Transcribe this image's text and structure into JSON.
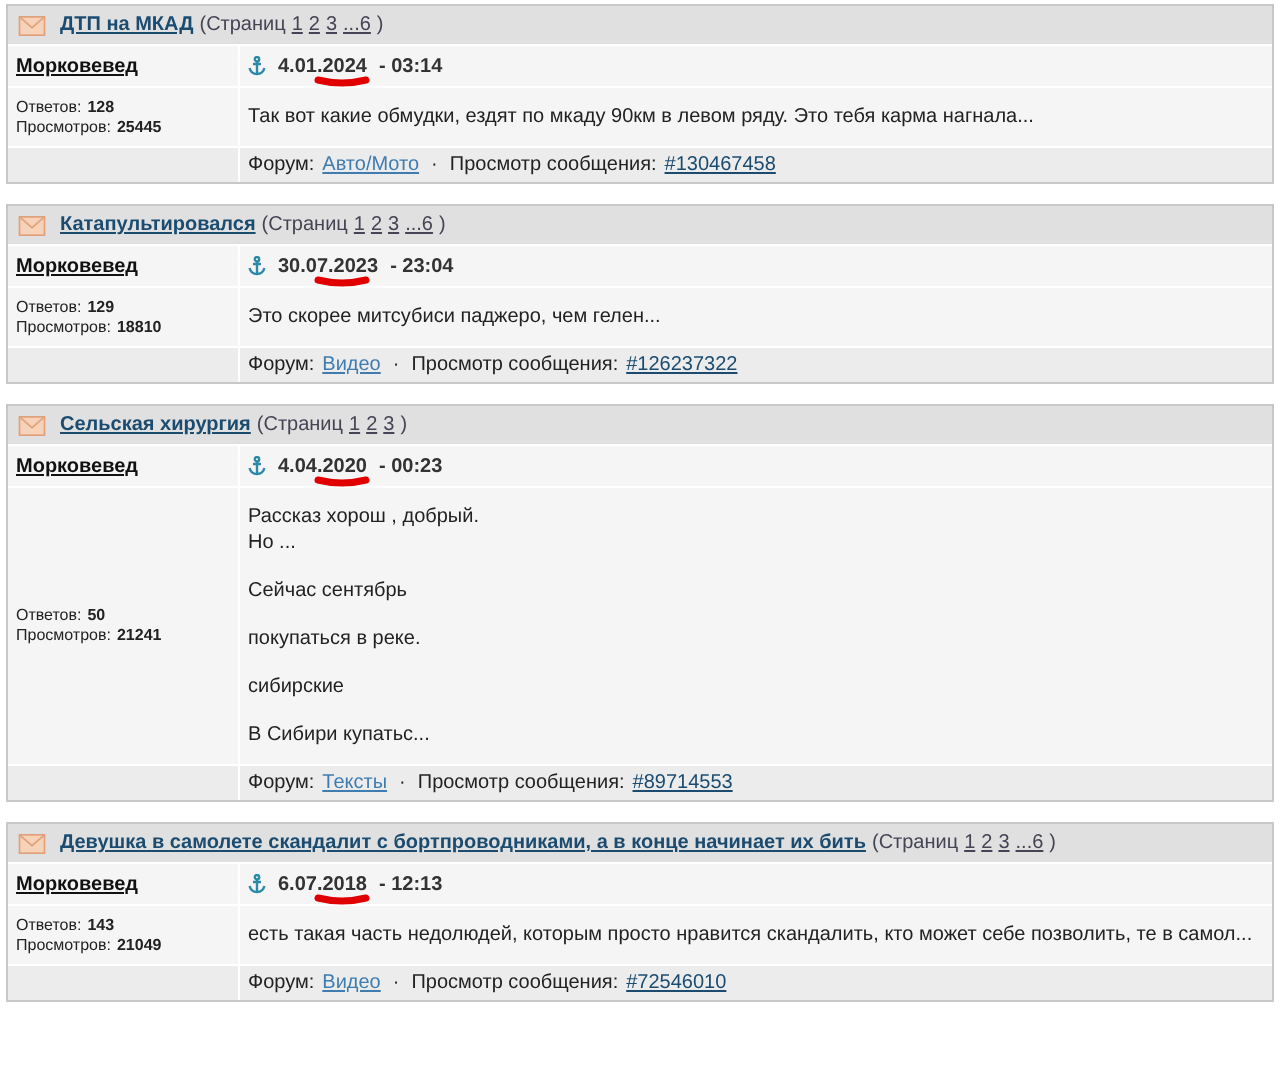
{
  "posts": [
    {
      "title": "ДТП на МКАД",
      "pages_label": "(Страниц",
      "pages": [
        "1",
        "2",
        "3",
        "...6"
      ],
      "pages_close": ")",
      "author": "Морковевед",
      "date": "4.01.2024",
      "time": "- 03:14",
      "marked": true,
      "replies_label": "Ответов:",
      "replies": "128",
      "views_label": "Просмотров:",
      "views": "25445",
      "paragraphs": [
        [
          "Так вот какие обмудки, ездят по мкаду 90км в левом ряду. Это тебя карма нагнала..."
        ]
      ],
      "forum_label": "Форум:",
      "forum": "Авто/Мото",
      "dot": "·",
      "message_label": "Просмотр сообщения:",
      "message_link": "#130467458"
    },
    {
      "title": "Катапультировался",
      "pages_label": "(Страниц",
      "pages": [
        "1",
        "2",
        "3",
        "...6"
      ],
      "pages_close": ")",
      "author": "Морковевед",
      "date": "30.07.2023",
      "time": "- 23:04",
      "marked": true,
      "replies_label": "Ответов:",
      "replies": "129",
      "views_label": "Просмотров:",
      "views": "18810",
      "paragraphs": [
        [
          "Это скорее митсубиси паджеро, чем гелен..."
        ]
      ],
      "forum_label": "Форум:",
      "forum": "Видео",
      "dot": "·",
      "message_label": "Просмотр сообщения:",
      "message_link": "#126237322"
    },
    {
      "title": "Сельская хирургия",
      "pages_label": "(Страниц",
      "pages": [
        "1",
        "2",
        "3"
      ],
      "pages_close": ")",
      "author": "Морковевед",
      "date": "4.04.2020",
      "time": "- 00:23",
      "marked": true,
      "replies_label": "Ответов:",
      "replies": "50",
      "views_label": "Просмотров:",
      "views": "21241",
      "paragraphs": [
        [
          "Рассказ хорош , добрый.",
          "Но ..."
        ],
        [
          "Сейчас сентябрь"
        ],
        [
          "покупаться в реке."
        ],
        [
          "сибирские"
        ],
        [
          "В Сибири купатьс..."
        ]
      ],
      "forum_label": "Форум:",
      "forum": "Тексты",
      "dot": "·",
      "message_label": "Просмотр сообщения:",
      "message_link": "#89714553"
    },
    {
      "title": "Девушка в самолете скандалит с бортпроводниками, а в конце начинает их бить",
      "pages_label": "(Страниц",
      "pages": [
        "1",
        "2",
        "3",
        "...6"
      ],
      "pages_close": ")",
      "author": "Морковевед",
      "date": "6.07.2018",
      "time": "- 12:13",
      "marked": true,
      "replies_label": "Ответов:",
      "replies": "143",
      "views_label": "Просмотров:",
      "views": "21049",
      "paragraphs": [
        [
          "есть такая часть недолюдей, которым просто нравится скандалить, кто может себе позволить, те в самол..."
        ]
      ],
      "forum_label": "Форум:",
      "forum": "Видео",
      "dot": "·",
      "message_label": "Просмотр сообщения:",
      "message_link": "#72546010"
    }
  ]
}
